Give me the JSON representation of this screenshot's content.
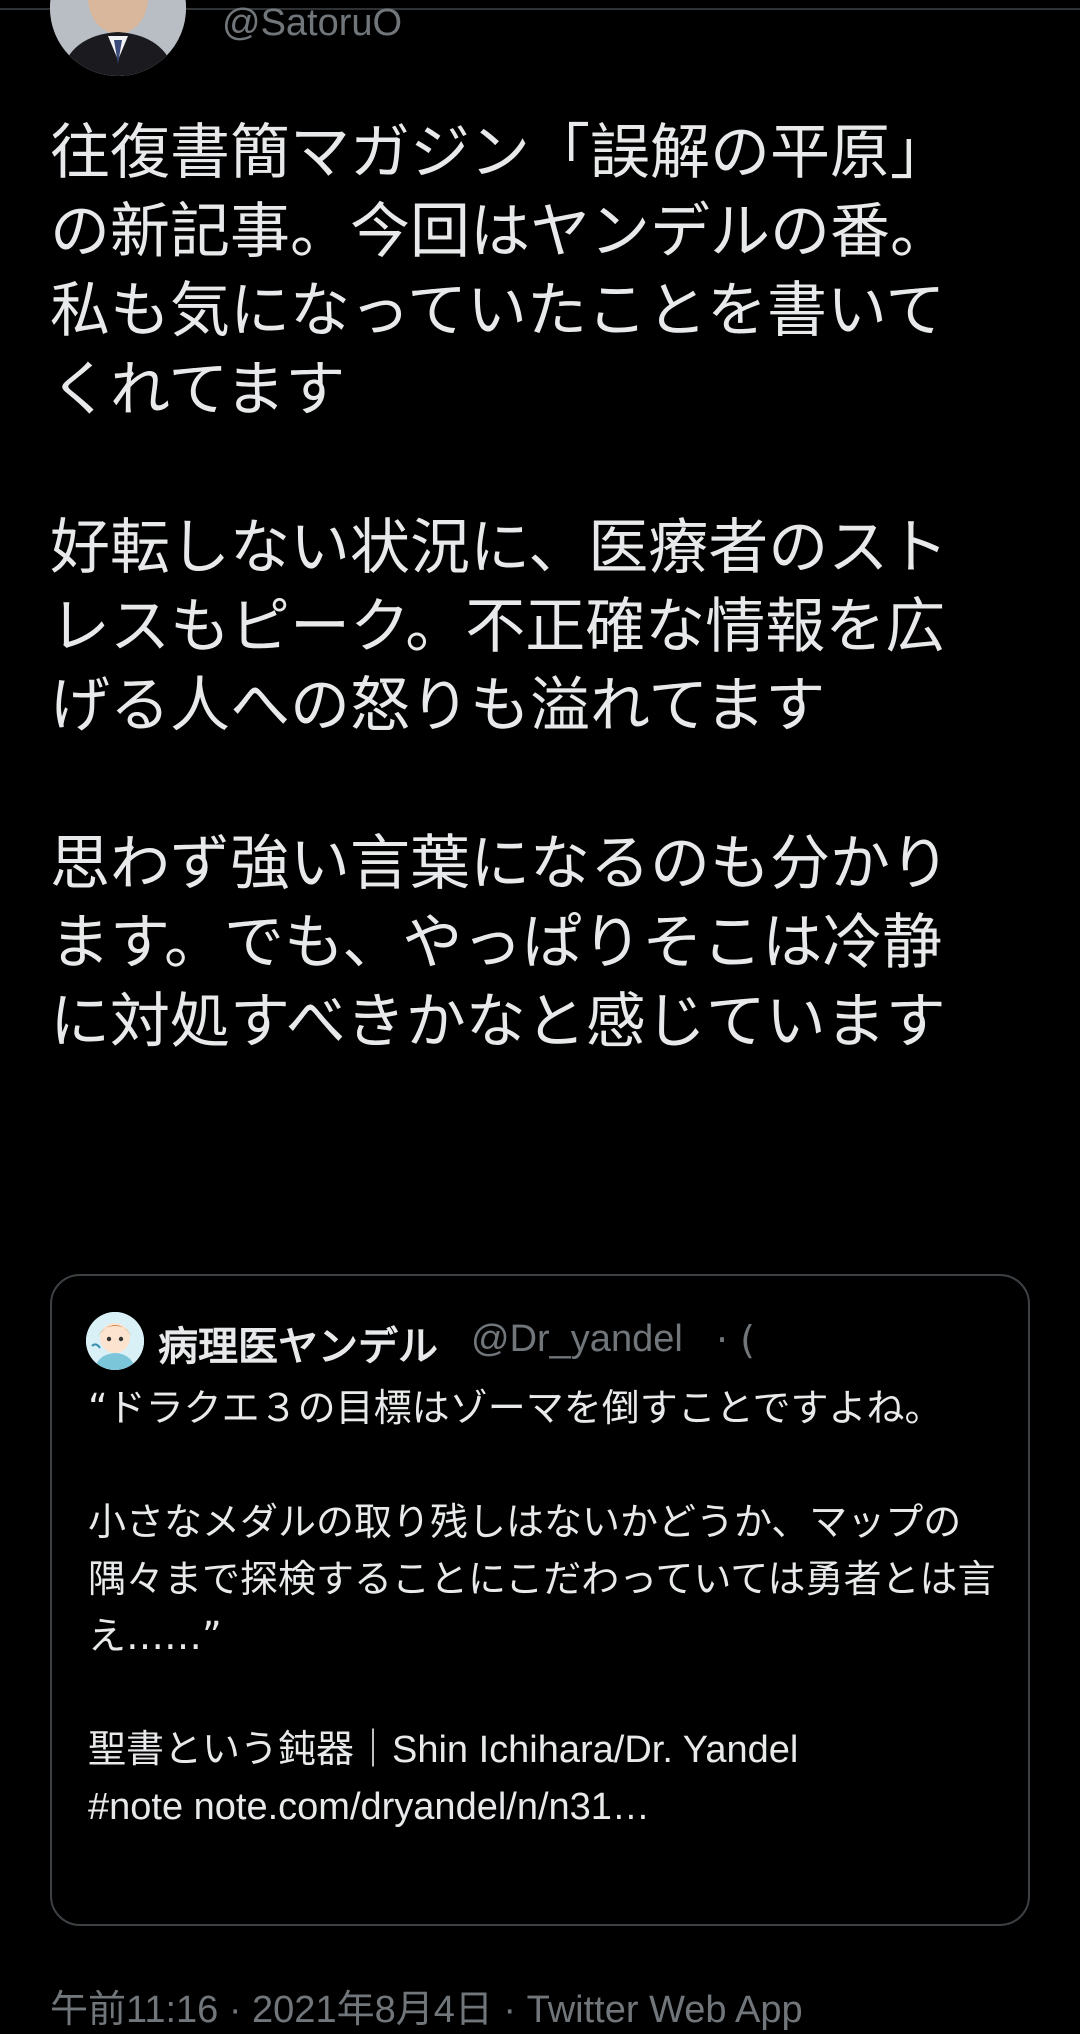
{
  "author": {
    "handle": "@SatoruO",
    "avatar_icon": "user-photo-avatar"
  },
  "tweet": {
    "paragraphs": [
      "往復書簡マガジン「誤解の平原」の新記事。今回はヤンデルの番。私も気になっていたことを書いてくれてます",
      "好転しない状況に、医療者のストレスもピーク。不正確な情報を広げる人への怒りも溢れてます",
      "思わず強い言葉になるのも分かります。でも、やっぱりそこは冷静に対処すべきかなと感じています"
    ]
  },
  "quote": {
    "name": "病理医ヤンデル",
    "handle": "@Dr_yandel",
    "separator": "· (",
    "avatar_icon": "illustrated-character-avatar",
    "paragraphs": [
      "“ドラクエ３の目標はゾーマを倒すことですよね。",
      "小さなメダルの取り残しはないかどうか、マップの隅々まで探検することにこだわっていては勇者とは言え……”"
    ],
    "link_line_1": "聖書という鈍器｜Shin Ichihara/Dr. Yandel",
    "link_line_2": "#note note.com/dryandel/n/n31…"
  },
  "meta": {
    "timestamp": "午前11:16 · 2021年8月4日 · Twitter Web App"
  },
  "colors": {
    "background": "#000000",
    "text": "#e7e9ea",
    "muted": "#71767b",
    "border": "#3e4144"
  }
}
